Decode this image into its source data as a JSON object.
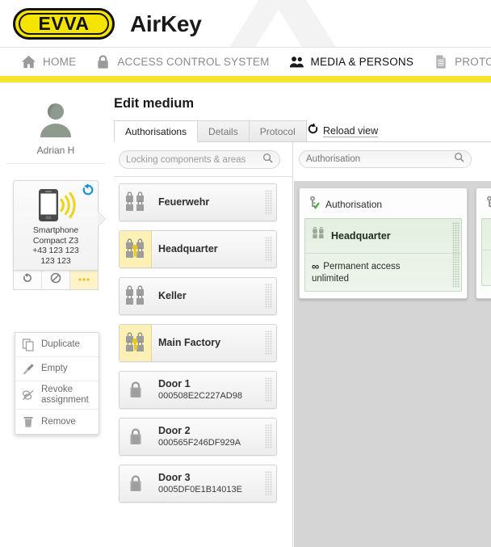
{
  "header": {
    "brand_logo_text": "EVVA",
    "product_name": "AirKey",
    "brand_yellow": "#f7e52a",
    "logo_yellow": "#f5e400"
  },
  "nav": {
    "items": [
      {
        "label": "HOME",
        "icon": "home-icon",
        "active": false
      },
      {
        "label": "ACCESS CONTROL SYSTEM",
        "icon": "lock-icon",
        "active": false
      },
      {
        "label": "MEDIA & PERSONS",
        "icon": "people-icon",
        "active": true
      },
      {
        "label": "PROTOCOLS",
        "icon": "document-icon",
        "active": false
      },
      {
        "label": "",
        "icon": "person-icon",
        "active": false
      }
    ]
  },
  "sidebar": {
    "person": {
      "name": "Adrian H",
      "avatar": "avatar-icon"
    },
    "medium": {
      "sync_badge": "sync-icon",
      "device_icon": "smartphone-nfc-icon",
      "lines": [
        "Smartphone",
        "Compact Z3",
        "+43 123 123",
        "123 123"
      ],
      "actions": [
        {
          "name": "refresh-action",
          "icon": "refresh-icon",
          "active": false
        },
        {
          "name": "block-action",
          "icon": "block-icon",
          "active": false
        },
        {
          "name": "more-action",
          "icon": "ellipsis-icon",
          "active": true
        }
      ]
    },
    "context_menu": [
      {
        "label": "Duplicate",
        "icon": "copy-icon"
      },
      {
        "label": "Empty",
        "icon": "broom-icon"
      },
      {
        "label": "Revoke assignment",
        "icon": "revoke-icon"
      },
      {
        "label": "Remove",
        "icon": "trash-icon"
      }
    ]
  },
  "main": {
    "page_title": "Edit medium",
    "tabs": [
      {
        "label": "Authorisations",
        "active": true
      },
      {
        "label": "Details",
        "active": false
      },
      {
        "label": "Protocol",
        "active": false
      }
    ],
    "reload": {
      "label": "Reload view",
      "icon": "reload-icon"
    },
    "list_search": {
      "value": "",
      "placeholder": "Locking components & areas",
      "icon": "search-icon"
    },
    "list_items": [
      {
        "title": "Feuerwehr",
        "subtitle": "",
        "icon": "area-locks-icon",
        "highlighted": false
      },
      {
        "title": "Headquarter",
        "subtitle": "",
        "icon": "area-locks-key-icon",
        "highlighted": true
      },
      {
        "title": "Keller",
        "subtitle": "",
        "icon": "area-locks-icon",
        "highlighted": false
      },
      {
        "title": "Main Factory",
        "subtitle": "",
        "icon": "area-locks-key-icon",
        "highlighted": true
      },
      {
        "title": "Door 1",
        "subtitle": "000508E2C227AD98",
        "icon": "lock-icon",
        "highlighted": false
      },
      {
        "title": "Door 2",
        "subtitle": "000565F246DF929A",
        "icon": "lock-icon",
        "highlighted": false
      },
      {
        "title": "Door 3",
        "subtitle": "0005DF0E1B14013E",
        "icon": "lock-icon",
        "highlighted": false
      }
    ],
    "auth_search": {
      "value": "",
      "placeholder": "Authorisation",
      "icon": "search-icon"
    },
    "auth_card": {
      "header_label": "Authorisation",
      "header_icon": "key-check-icon",
      "name": "Headquarter",
      "name_icon": "area-locks-icon",
      "permission_label": "Permanent access",
      "permission_icon": "infinity-icon",
      "duration": "unlimited",
      "accent_green": "#e3efe0"
    }
  }
}
